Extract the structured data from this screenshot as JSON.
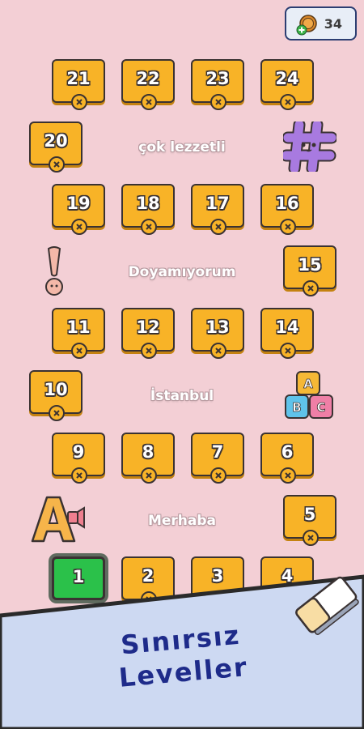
{
  "coins": {
    "count": "34"
  },
  "levels": {
    "l1": "1",
    "l2": "2",
    "l3": "3",
    "l4": "4",
    "l5": "5",
    "l6": "6",
    "l7": "7",
    "l8": "8",
    "l9": "9",
    "l10": "10",
    "l11": "11",
    "l12": "12",
    "l13": "13",
    "l14": "14",
    "l15": "15",
    "l16": "16",
    "l17": "17",
    "l18": "18",
    "l19": "19",
    "l20": "20",
    "l21": "21",
    "l22": "22",
    "l23": "23",
    "l24": "24"
  },
  "section_labels": {
    "merhaba": "Merhaba",
    "istanbul": "İstanbul",
    "doyamiyorum": "Doyamıyorum",
    "cok_lezzetli": "çok lezzetli"
  },
  "promo": {
    "line1": "Sınırsız",
    "line2": "Leveller"
  },
  "icons": {
    "coin": "coin-plus-icon",
    "lock": "lock-x-icon",
    "hashtag": "purple-hashtag-mascot-icon",
    "exclamation": "exclamation-mascot-icon",
    "abc_blocks": "abc-blocks-icon",
    "letter_a": "letter-a-megaphone-icon",
    "eraser": "eraser-icon"
  },
  "colors": {
    "background": "#f3cfd5",
    "tile": "#f8b327",
    "active_tile": "#2bc14a",
    "promo_text": "#1e2b8a"
  }
}
